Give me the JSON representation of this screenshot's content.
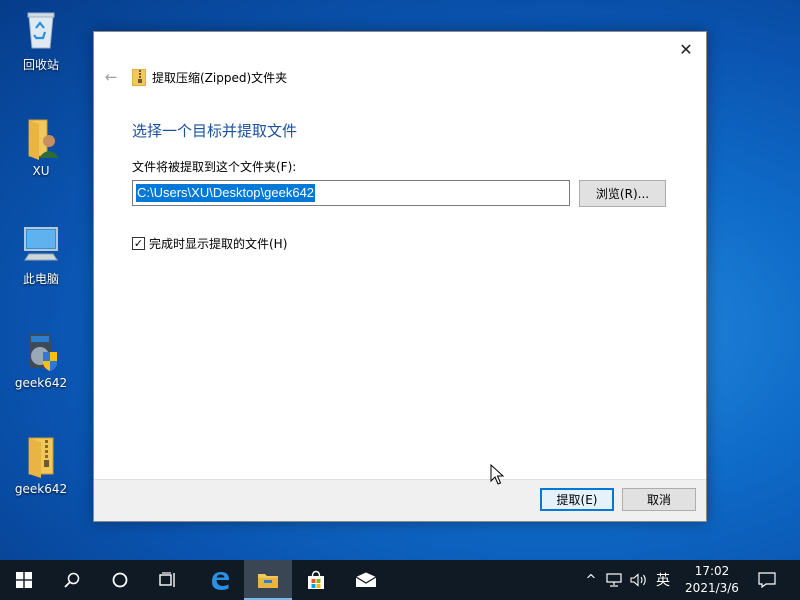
{
  "desktop": {
    "icons": [
      {
        "label": "回收站",
        "icon": "recycle-bin-icon"
      },
      {
        "label": "XU",
        "icon": "user-folder-icon"
      },
      {
        "label": "此电脑",
        "icon": "computer-icon"
      },
      {
        "label": "geek642",
        "icon": "installer-icon"
      },
      {
        "label": "geek642",
        "icon": "zip-folder-icon"
      }
    ]
  },
  "dialog": {
    "title": "提取压缩(Zipped)文件夹",
    "heading": "选择一个目标并提取文件",
    "path_label": "文件将被提取到这个文件夹(F):",
    "path_value": "C:\\Users\\XU\\Desktop\\geek642",
    "browse_label": "浏览(R)...",
    "checkbox_label": "完成时显示提取的文件(H)",
    "checkbox_checked": true,
    "extract_label": "提取(E)",
    "cancel_label": "取消"
  },
  "taskbar": {
    "ime": "英",
    "time": "17:02",
    "date": "2021/3/6"
  },
  "colors": {
    "accent": "#0078d7",
    "heading": "#1a50a0",
    "taskbar": "#101a24"
  }
}
